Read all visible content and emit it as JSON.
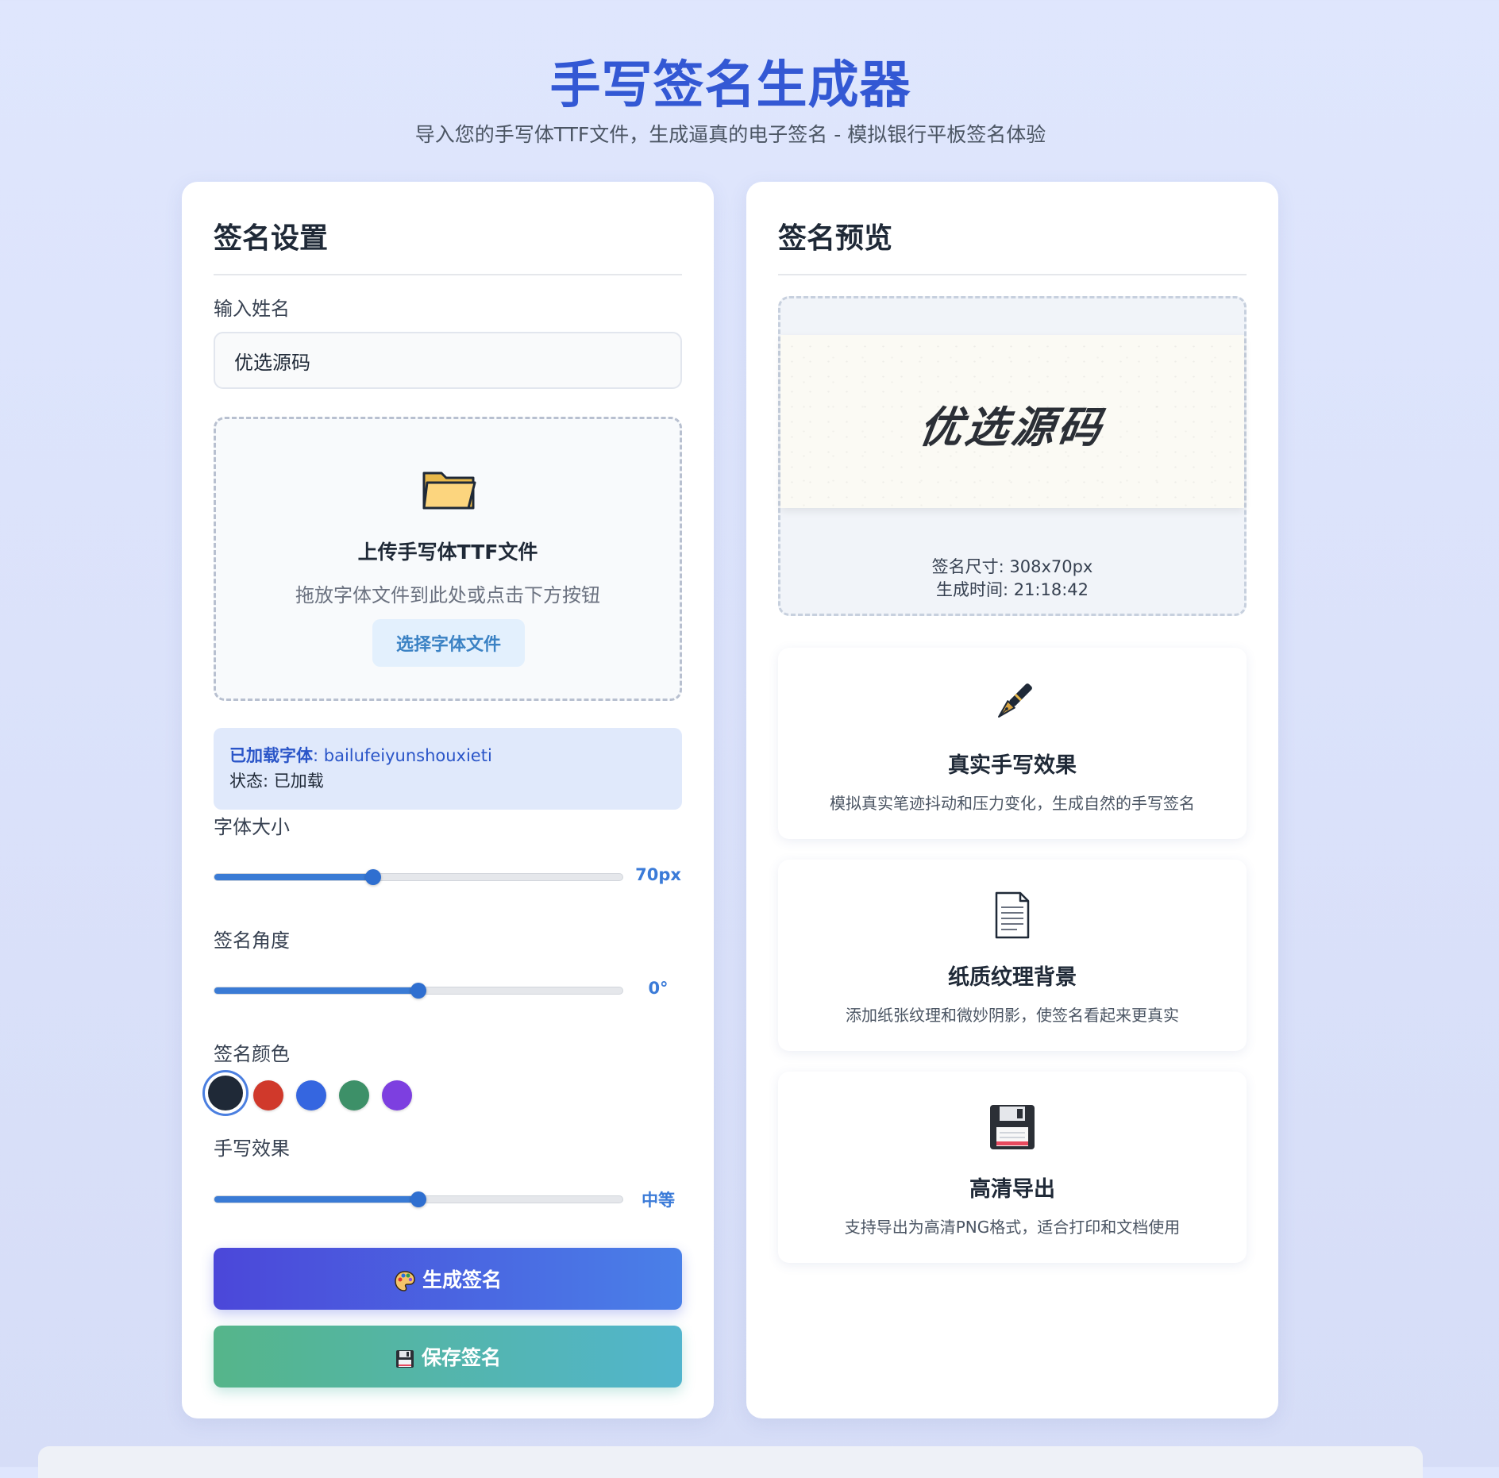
{
  "header": {
    "title": "手写签名生成器",
    "subtitle": "导入您的手写体TTF文件，生成逼真的电子签名 - 模拟银行平板签名体验"
  },
  "settings": {
    "heading": "签名设置",
    "name_label": "输入姓名",
    "name_value": "优选源码",
    "upload": {
      "icon": "folder-icon",
      "title": "上传手写体TTF文件",
      "hint": "拖放字体文件到此处或点击下方按钮",
      "button_label": "选择字体文件"
    },
    "font_info": {
      "loaded_key": "已加载字体",
      "loaded_value": ": bailufeiyunshouxieti",
      "status_text": "状态: 已加载"
    },
    "font_size": {
      "label": "字体大小",
      "value_text": "70px",
      "fraction": 0.39
    },
    "angle": {
      "label": "签名角度",
      "value_text": "0°",
      "fraction": 0.5
    },
    "color": {
      "label": "签名颜色",
      "swatches": [
        {
          "color": "#1f2937",
          "selected": true
        },
        {
          "color": "#d0392b",
          "selected": false
        },
        {
          "color": "#3566e0",
          "selected": false
        },
        {
          "color": "#3d9068",
          "selected": false
        },
        {
          "color": "#7d3fe0",
          "selected": false
        }
      ]
    },
    "effect": {
      "label": "手写效果",
      "value_text": "中等",
      "fraction": 0.5
    },
    "generate_button": {
      "icon": "palette-icon",
      "label": "生成签名"
    },
    "save_button": {
      "icon": "floppy-disk-icon",
      "label": "保存签名"
    }
  },
  "preview": {
    "heading": "签名预览",
    "signature_text": "优选源码",
    "size_text": "签名尺寸: 308x70px",
    "time_text": "生成时间: 21:18:42"
  },
  "features": [
    {
      "icon": "fountain-pen-icon",
      "title": "真实手写效果",
      "desc": "模拟真实笔迹抖动和压力变化，生成自然的手写签名"
    },
    {
      "icon": "document-icon",
      "title": "纸质纹理背景",
      "desc": "添加纸张纹理和微妙阴影，使签名看起来更真实"
    },
    {
      "icon": "floppy-disk-icon",
      "title": "高清导出",
      "desc": "支持导出为高清PNG格式，适合打印和文档使用"
    }
  ],
  "colors": {
    "accent": "#3358d4",
    "slider": "#3a7bd5"
  }
}
